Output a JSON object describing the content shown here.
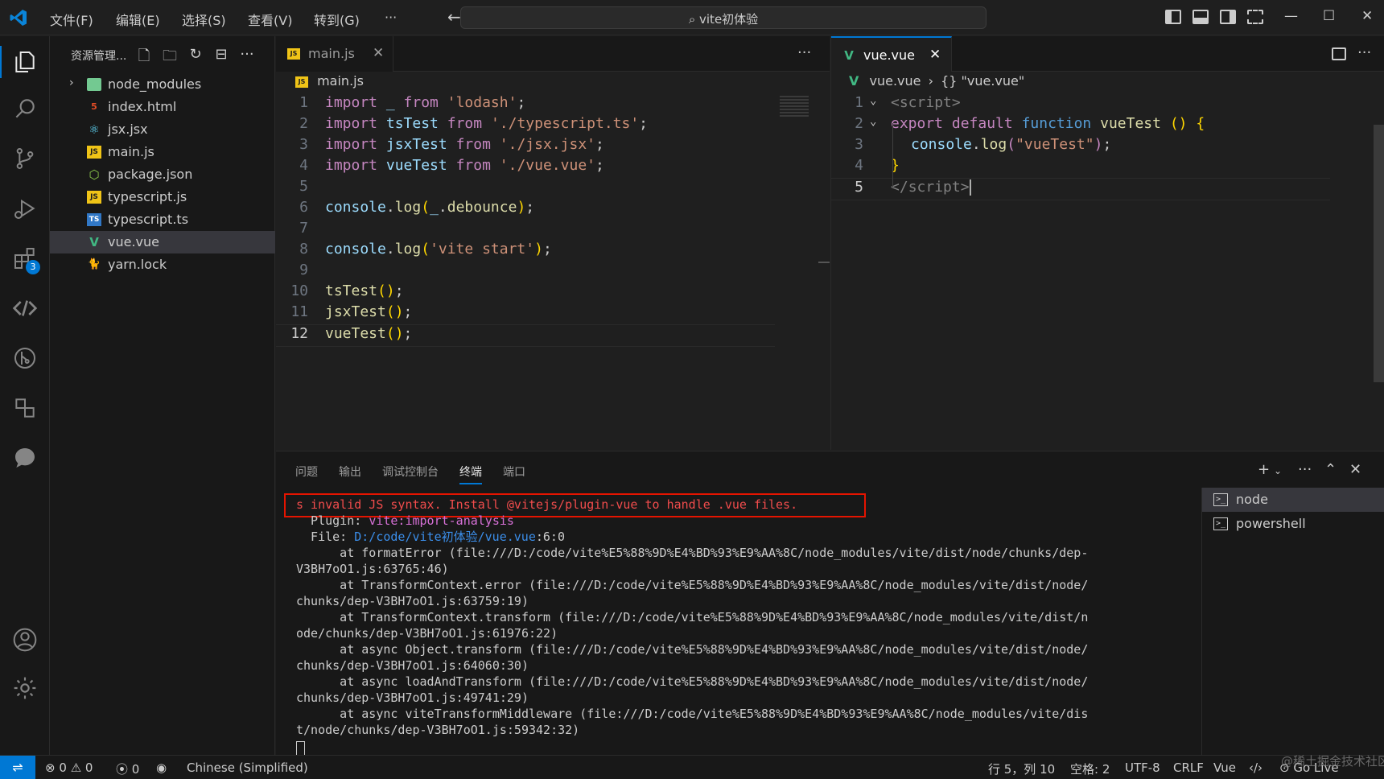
{
  "titlebar": {
    "menus": [
      "文件(F)",
      "编辑(E)",
      "选择(S)",
      "查看(V)",
      "转到(G)",
      "···"
    ],
    "search_text": "vite初体验",
    "back_icon": "←",
    "forward_icon": "→",
    "minimize": "—",
    "maximize": "☐",
    "close": "✕"
  },
  "sidebar": {
    "title": "资源管理...",
    "more": "···",
    "items": [
      {
        "label": "node_modules",
        "icon": "folder-icon",
        "badge": "",
        "color": "#73c991"
      },
      {
        "label": "index.html",
        "icon": "html-icon",
        "badge": "5",
        "color": "#e44d26"
      },
      {
        "label": "jsx.jsx",
        "icon": "react-icon",
        "badge": "⚛",
        "color": "#61dafb"
      },
      {
        "label": "main.js",
        "icon": "js-icon",
        "badge": "JS",
        "color": "#f0c417"
      },
      {
        "label": "package.json",
        "icon": "node-icon",
        "badge": "⬡",
        "color": "#8cc84b"
      },
      {
        "label": "typescript.js",
        "icon": "js-icon",
        "badge": "JS",
        "color": "#f0c417"
      },
      {
        "label": "typescript.ts",
        "icon": "ts-icon",
        "badge": "TS",
        "color": "#3178c6"
      },
      {
        "label": "vue.vue",
        "icon": "vue-icon",
        "badge": "V",
        "color": "#41b883"
      },
      {
        "label": "yarn.lock",
        "icon": "yarn-icon",
        "badge": "🐈",
        "color": "#2c8ebb"
      }
    ],
    "chevron": "›"
  },
  "activity": {
    "extensions_badge": "3"
  },
  "editor1": {
    "tab_label": "main.js",
    "tab_badge": "JS",
    "close": "✕",
    "more": "···",
    "breadcrumb": "main.js",
    "lines": [
      "1",
      "2",
      "3",
      "4",
      "5",
      "6",
      "7",
      "8",
      "9",
      "10",
      "11",
      "12"
    ],
    "code": {
      "l1": [
        "import",
        " _ ",
        "from",
        " ",
        "'lodash'",
        ";"
      ],
      "l2": [
        "import",
        " tsTest ",
        "from",
        " ",
        "'./typescript.ts'",
        ";"
      ],
      "l3": [
        "import",
        " jsxTest ",
        "from",
        " ",
        "'./jsx.jsx'",
        ";"
      ],
      "l4": [
        "import",
        " vueTest ",
        "from",
        " ",
        "'./vue.vue'",
        ";"
      ],
      "l6": [
        "console",
        ".",
        "log",
        "(",
        "_",
        ".",
        "debounce",
        ")",
        ";"
      ],
      "l8": [
        "console",
        ".",
        "log",
        "(",
        "'vite start'",
        ")",
        ";"
      ],
      "l10": [
        "tsTest",
        "()",
        ";"
      ],
      "l11": [
        "jsxTest",
        "()",
        ";"
      ],
      "l12": [
        "vueTest",
        "()",
        ";"
      ]
    }
  },
  "editor2": {
    "tab_label": "vue.vue",
    "tab_badge": "V",
    "close": "✕",
    "more": "···",
    "breadcrumb_file": "vue.vue",
    "breadcrumb_sep": "›",
    "breadcrumb_sym": "{} \"vue.vue\"",
    "lines": [
      "1",
      "2",
      "3",
      "4",
      "5"
    ],
    "code": {
      "l1": [
        "<",
        "script",
        ">"
      ],
      "l2": [
        "export",
        " ",
        "default",
        " ",
        "function",
        " ",
        "vueTest",
        " ",
        "()",
        " ",
        "{"
      ],
      "l3": [
        "console",
        ".",
        "log",
        "(",
        "\"vueTest\"",
        ")",
        ";"
      ],
      "l4": [
        "}"
      ],
      "l5": [
        "</",
        "script",
        ">"
      ]
    }
  },
  "panel": {
    "tabs": [
      "问题",
      "输出",
      "调试控制台",
      "终端",
      "端口"
    ],
    "active_tab": "终端",
    "add": "+",
    "more": "···",
    "terminal": {
      "error": "s invalid JS syntax. Install @vitejs/plugin-vue to handle .vue files.",
      "plugin_label": "  Plugin: ",
      "plugin_value": "vite:import-analysis",
      "file_label": "  File: ",
      "file_value": "D:/code/vite初体验/vue.vue",
      "file_pos": ":6:0",
      "stack": [
        "      at formatError (file:///D:/code/vite%E5%88%9D%E4%BD%93%E9%AA%8C/node_modules/vite/dist/node/chunks/dep-",
        "V3BH7oO1.js:63765:46)",
        "      at TransformContext.error (file:///D:/code/vite%E5%88%9D%E4%BD%93%E9%AA%8C/node_modules/vite/dist/node/",
        "chunks/dep-V3BH7oO1.js:63759:19)",
        "      at TransformContext.transform (file:///D:/code/vite%E5%88%9D%E4%BD%93%E9%AA%8C/node_modules/vite/dist/n",
        "ode/chunks/dep-V3BH7oO1.js:61976:22)",
        "      at async Object.transform (file:///D:/code/vite%E5%88%9D%E4%BD%93%E9%AA%8C/node_modules/vite/dist/node/",
        "chunks/dep-V3BH7oO1.js:64060:30)",
        "      at async loadAndTransform (file:///D:/code/vite%E5%88%9D%E4%BD%93%E9%AA%8C/node_modules/vite/dist/node/",
        "chunks/dep-V3BH7oO1.js:49741:29)",
        "      at async viteTransformMiddleware (file:///D:/code/vite%E5%88%9D%E4%BD%93%E9%AA%8C/node_modules/vite/dis",
        "t/node/chunks/dep-V3BH7oO1.js:59342:32)"
      ]
    },
    "terminals": [
      {
        "label": "node",
        "selected": true
      },
      {
        "label": "powershell",
        "selected": false
      }
    ],
    "term_icon": ">_"
  },
  "statusbar": {
    "remote": "⇌",
    "errors": "0",
    "warnings": "0",
    "ports": "0",
    "language_pack": "Chinese (Simplified)",
    "cursor": "行 5，列 10",
    "spaces": "空格: 2",
    "encoding": "UTF-8",
    "eol": "CRLF",
    "language": "Vue",
    "golive": "Go Live",
    "watermark": "@稀土掘金技术社区"
  },
  "colors": {
    "accent": "#0078d4",
    "error_border": "#e51400"
  }
}
